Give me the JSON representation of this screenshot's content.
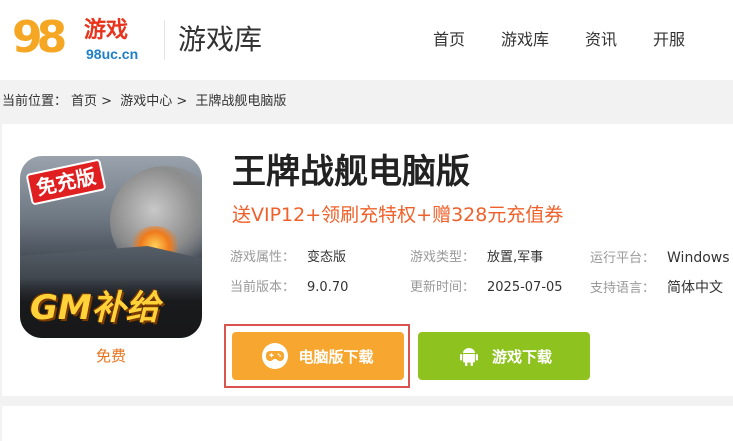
{
  "header": {
    "logo": {
      "number": "98",
      "cn": "游戏",
      "url": "98uc.cn"
    },
    "site_title": "游戏库",
    "nav": [
      "首页",
      "游戏库",
      "资讯",
      "开服"
    ]
  },
  "breadcrumb": {
    "prefix": "当前位置：",
    "items": [
      "首页",
      "游戏中心",
      "王牌战舰电脑版"
    ],
    "separator": ">"
  },
  "game": {
    "icon_badge": "免充版",
    "icon_text": "GM补给",
    "price_label": "免费",
    "title": "王牌战舰电脑版",
    "promo": "送VIP12+领刷充特权+赠328元充值券",
    "info": [
      {
        "key": "游戏属性：",
        "value": "变态版"
      },
      {
        "key": "游戏类型：",
        "value": "放置,军事"
      },
      {
        "key": "运行平台：",
        "value": "Windows"
      },
      {
        "key": "当前版本：",
        "value": "9.0.70"
      },
      {
        "key": "更新时间：",
        "value": "2025-07-05"
      },
      {
        "key": "支持语言：",
        "value": "简体中文"
      }
    ],
    "buttons": {
      "pc_download": "电脑版下载",
      "android_download": "游戏下载"
    }
  },
  "colors": {
    "accent_orange": "#f7a630",
    "accent_green": "#8dc21f",
    "promo_red": "#f0602a",
    "highlight_outline": "#d9534f"
  }
}
